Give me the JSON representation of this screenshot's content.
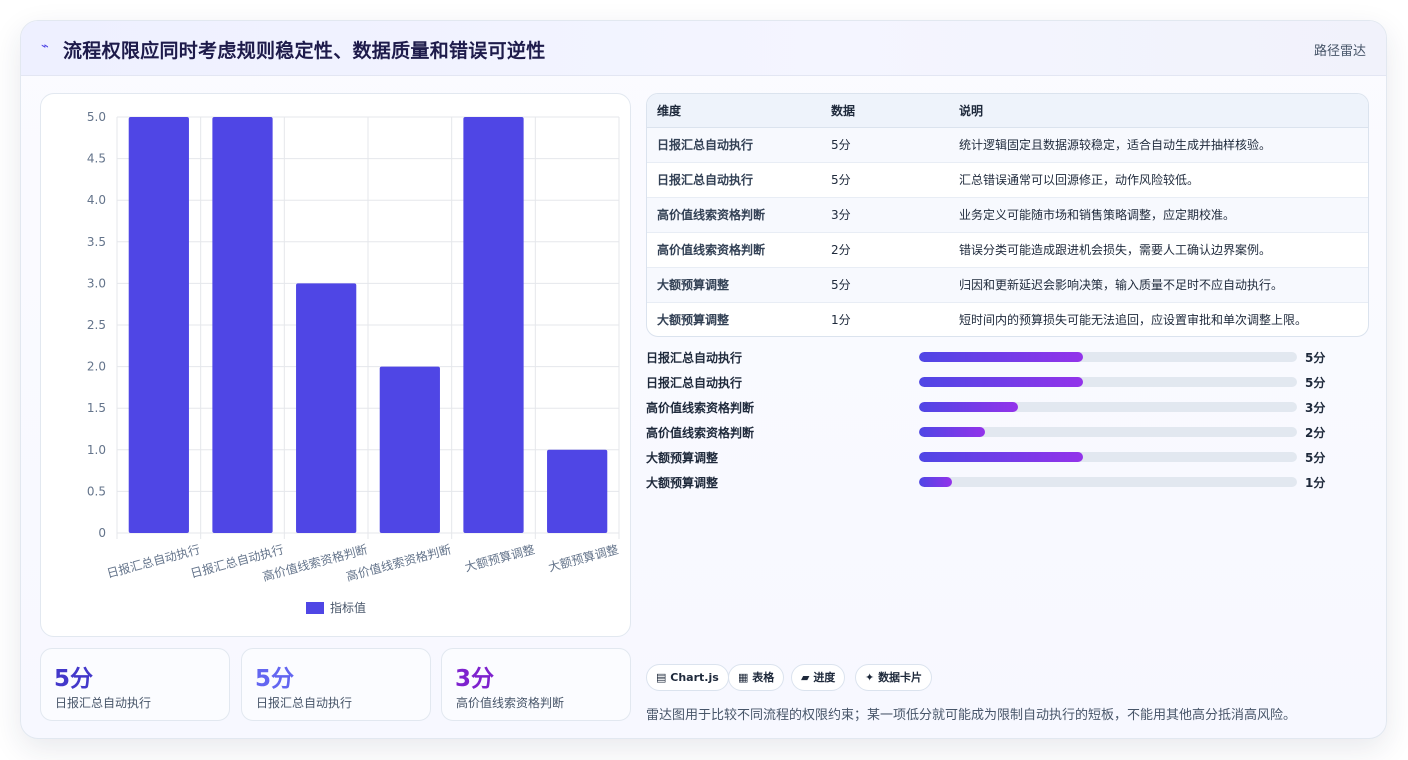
{
  "header": {
    "icon": "route-icon",
    "title": "流程权限应同时考虑规则稳定性、数据质量和错误可逆性",
    "tag": "路径雷达"
  },
  "colors": {
    "accent": "#4f46e5",
    "accent_light": "#6366f1",
    "purple": "#9333ea",
    "bar": "#4f46e5"
  },
  "chart_data": {
    "type": "bar",
    "categories": [
      "日报汇总自动执行",
      "日报汇总自动执行",
      "高价值线索资格判断",
      "高价值线索资格判断",
      "大额预算调整",
      "大额预算调整"
    ],
    "series": [
      {
        "name": "指标值",
        "values": [
          5,
          5,
          3,
          2,
          5,
          1
        ]
      }
    ],
    "ylim": [
      0,
      5
    ],
    "yticks": [
      "0",
      "0.5",
      "1.0",
      "1.5",
      "2.0",
      "2.5",
      "3.0",
      "3.5",
      "4.0",
      "4.5",
      "5.0"
    ],
    "legend": "bottom",
    "grid": true
  },
  "stats": [
    {
      "value": "5分",
      "label": "日报汇总自动执行",
      "color": "#4338ca"
    },
    {
      "value": "5分",
      "label": "日报汇总自动执行",
      "color": "#6366f1"
    },
    {
      "value": "3分",
      "label": "高价值线索资格判断",
      "color": "#7e22ce"
    }
  ],
  "table": {
    "headers": [
      "维度",
      "数据",
      "说明"
    ],
    "rows": [
      [
        "日报汇总自动执行",
        "5分",
        "统计逻辑固定且数据源较稳定，适合自动生成并抽样核验。"
      ],
      [
        "日报汇总自动执行",
        "5分",
        "汇总错误通常可以回源修正，动作风险较低。"
      ],
      [
        "高价值线索资格判断",
        "3分",
        "业务定义可能随市场和销售策略调整，应定期校准。"
      ],
      [
        "高价值线索资格判断",
        "2分",
        "错误分类可能造成跟进机会损失，需要人工确认边界案例。"
      ],
      [
        "大额预算调整",
        "5分",
        "归因和更新延迟会影响决策，输入质量不足时不应自动执行。"
      ],
      [
        "大额预算调整",
        "1分",
        "短时间内的预算损失可能无法追回，应设置审批和单次调整上限。"
      ]
    ]
  },
  "progress": [
    {
      "label": "日报汇总自动执行",
      "value": "5分",
      "score": 5
    },
    {
      "label": "日报汇总自动执行",
      "value": "5分",
      "score": 5
    },
    {
      "label": "高价值线索资格判断",
      "value": "3分",
      "score": 3
    },
    {
      "label": "高价值线索资格判断",
      "value": "2分",
      "score": 2
    },
    {
      "label": "大额预算调整",
      "value": "5分",
      "score": 5
    },
    {
      "label": "大额预算调整",
      "value": "1分",
      "score": 1
    }
  ],
  "progress_max": 11.5,
  "chips": [
    {
      "icon": "chart-icon",
      "glyph": "▤",
      "label": "Chart.js"
    },
    {
      "icon": "table-icon",
      "glyph": "▦",
      "label": "表格"
    },
    {
      "icon": "progress-icon",
      "glyph": "▰",
      "label": "进度"
    },
    {
      "icon": "sparkle-icon",
      "glyph": "✦",
      "label": "数据卡片"
    }
  ],
  "footer_note": "雷达图用于比较不同流程的权限约束；某一项低分就可能成为限制自动执行的短板，不能用其他高分抵消高风险。"
}
